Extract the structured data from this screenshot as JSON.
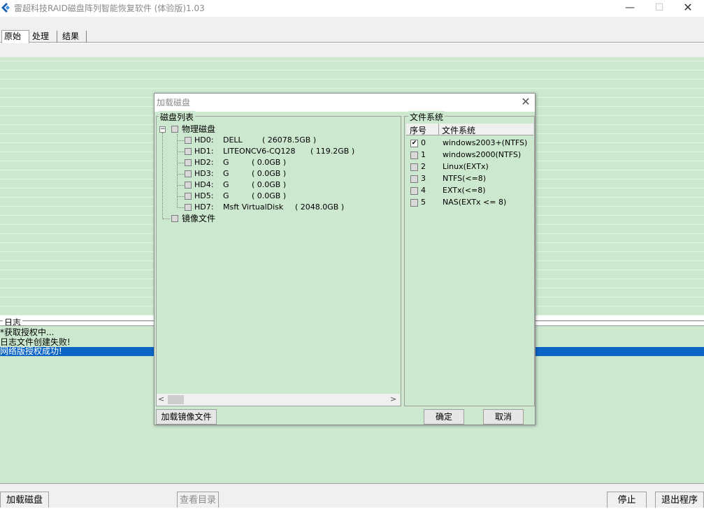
{
  "window": {
    "title": "雷超科技RAID磁盘阵列智能恢复软件 (体验版)1.03",
    "min": "—",
    "max": "☐",
    "close": "✕"
  },
  "tabs": [
    "原始",
    "处理",
    "结果"
  ],
  "log": {
    "label": "日志",
    "lines": [
      "*获取授权中...",
      "日志文件创建失败!",
      "网络版授权成功!"
    ]
  },
  "bottom": {
    "load_disk": "加载磁盘",
    "view_dir": "查看目录",
    "stop": "停止",
    "exit": "退出程序"
  },
  "dialog": {
    "title": "加载磁盘",
    "close": "✕",
    "disk_group": "磁盘列表",
    "fs_group": "文件系统",
    "tree": {
      "root": "物理磁盘",
      "expander": "−",
      "disks": [
        {
          "id": "HD0:",
          "name": "DELL",
          "size": "( 26078.5GB )"
        },
        {
          "id": "HD1:",
          "name": "LITEONCV6-CQ128",
          "size": "( 119.2GB )"
        },
        {
          "id": "HD2:",
          "name": "G",
          "size": "( 0.0GB )"
        },
        {
          "id": "HD3:",
          "name": "G",
          "size": "( 0.0GB )"
        },
        {
          "id": "HD4:",
          "name": "G",
          "size": "( 0.0GB )"
        },
        {
          "id": "HD5:",
          "name": "G",
          "size": "( 0.0GB )"
        },
        {
          "id": "HD7:",
          "name": "Msft VirtualDisk",
          "size": "( 2048.0GB )"
        }
      ],
      "image_node": "镜像文件"
    },
    "fs_columns": [
      "序号",
      "文件系统"
    ],
    "fs_rows": [
      {
        "index": "0",
        "name": "windows2003+(NTFS)",
        "checked": true
      },
      {
        "index": "1",
        "name": "windows2000(NTFS)",
        "checked": false
      },
      {
        "index": "2",
        "name": "Linux(EXTx)",
        "checked": false
      },
      {
        "index": "3",
        "name": "NTFS(<=8)",
        "checked": false
      },
      {
        "index": "4",
        "name": "EXTx(<=8)",
        "checked": false
      },
      {
        "index": "5",
        "name": "NAS(EXTx <= 8)",
        "checked": false
      }
    ],
    "scroll_left": "<",
    "scroll_right": ">",
    "buttons": {
      "load_image": "加载镜像文件",
      "ok": "确定",
      "cancel": "取消"
    },
    "check_mark": "✔"
  }
}
